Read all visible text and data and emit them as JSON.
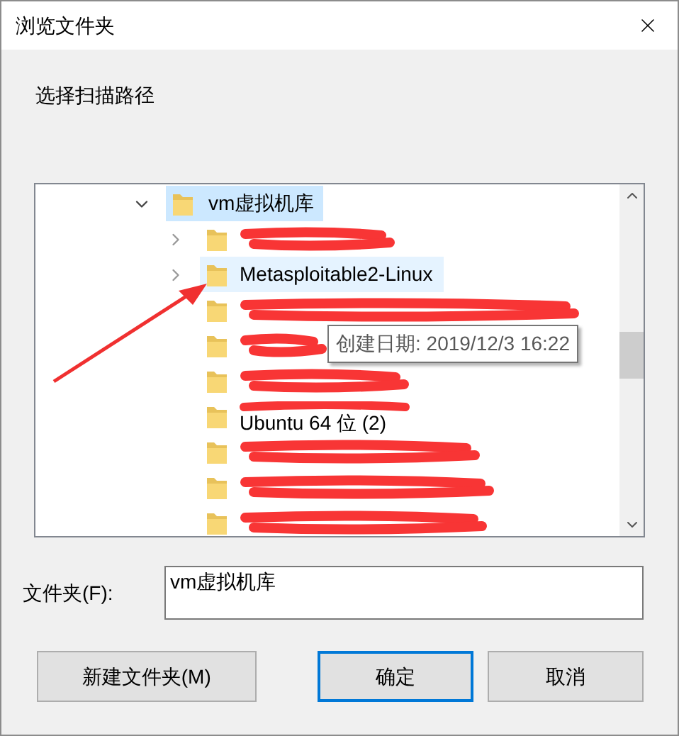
{
  "window": {
    "title": "浏览文件夹"
  },
  "prompt": "选择扫描路径",
  "tree": {
    "items": [
      {
        "label": "vm虚拟机库",
        "expanded": true,
        "selected": true,
        "children": [
          {
            "kind": "redacted",
            "has_children": true,
            "hovered": false
          },
          {
            "kind": "normal",
            "label": "Metasploitable2-Linux",
            "has_children": true,
            "hovered": true
          },
          {
            "kind": "redacted",
            "has_children": false,
            "hovered": false
          },
          {
            "kind": "redacted",
            "has_children": false,
            "hovered": false
          },
          {
            "kind": "redacted",
            "has_children": false,
            "hovered": false
          },
          {
            "kind": "partly_redacted",
            "label": "Ubuntu 64 位 (2)",
            "has_children": false,
            "hovered": false
          },
          {
            "kind": "redacted",
            "has_children": false,
            "hovered": false
          },
          {
            "kind": "redacted",
            "has_children": false,
            "hovered": false
          },
          {
            "kind": "redacted",
            "has_children": false,
            "hovered": false
          }
        ]
      }
    ]
  },
  "tooltip": {
    "text": "创建日期: 2019/12/3 16:22"
  },
  "folder_field": {
    "label": "文件夹(F):",
    "value": "vm虚拟机库"
  },
  "buttons": [
    {
      "label": "新建文件夹(M)",
      "default": false
    },
    {
      "label": "确定",
      "default": true
    },
    {
      "label": "取消",
      "default": false
    }
  ]
}
